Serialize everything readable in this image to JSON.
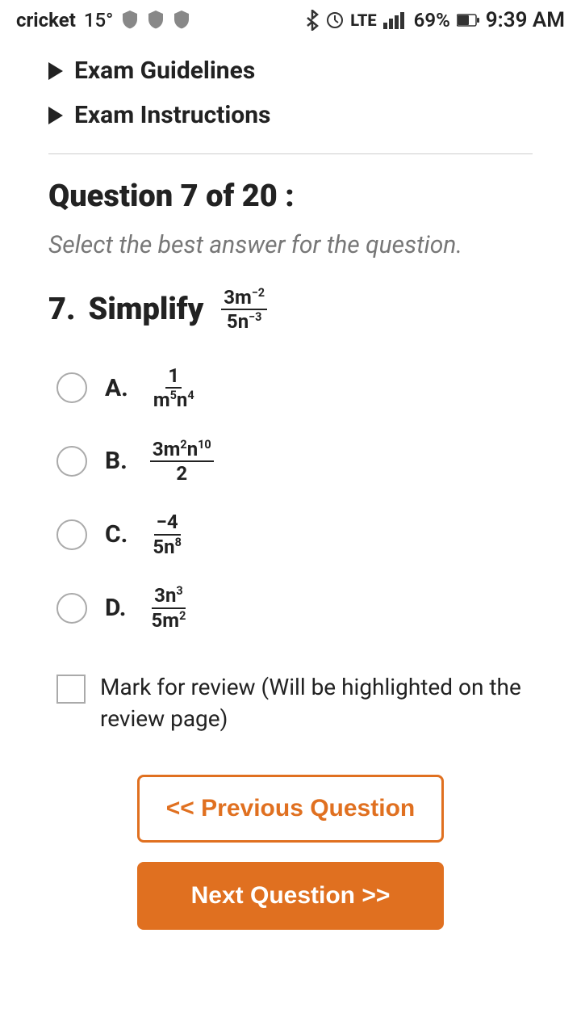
{
  "statusBar": {
    "carrier": "cricket",
    "temp": "15°",
    "battery": "69%",
    "time": "9:39 AM"
  },
  "menu": {
    "guidelines_label": "Exam Guidelines",
    "instructions_label": "Exam Instructions"
  },
  "question": {
    "header": "Question 7 of 20 :",
    "instruction": "Select the best answer for the question.",
    "number": "7.",
    "verb": "Simplify"
  },
  "options": [
    {
      "letter": "A.",
      "display": "1 / (m⁵n⁴)"
    },
    {
      "letter": "B.",
      "display": "3m²n¹⁰ / 2"
    },
    {
      "letter": "C.",
      "display": "−4 / 5n⁸"
    },
    {
      "letter": "D.",
      "display": "3n³ / 5m²"
    }
  ],
  "review": {
    "label": "Mark for review (Will be highlighted on the review page)"
  },
  "buttons": {
    "previous": "<< Previous Question",
    "next": "Next Question >>"
  }
}
